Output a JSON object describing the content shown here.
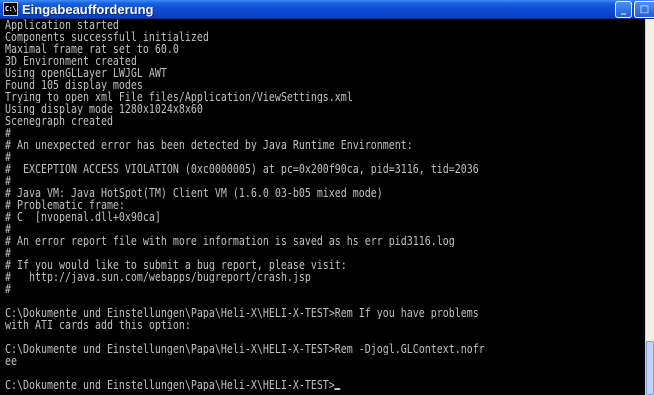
{
  "window": {
    "title": "Eingabeaufforderung",
    "icon_text": "C:\\",
    "minimize_glyph": "_",
    "maximize_glyph": "□"
  },
  "console": {
    "lines": [
      "Application started",
      "Components successfull initialized",
      "Maximal frame rat set to 60.0",
      "3D Environment created",
      "Using openGLLayer LWJGL_AWT",
      "Found 105 display modes",
      "Trying to open xml File files/Application/ViewSettings.xml",
      "Using display mode 1280x1024x8x60",
      "Scenegraph created",
      "#",
      "# An unexpected error has been detected by Java Runtime Environment:",
      "#",
      "#  EXCEPTION_ACCESS_VIOLATION (0xc0000005) at pc=0x200f90ca, pid=3116, tid=2036",
      "#",
      "# Java VM: Java HotSpot(TM) Client VM (1.6.0_03-b05 mixed mode)",
      "# Problematic frame:",
      "# C  [nvopenal.dll+0x90ca]",
      "#",
      "# An error report file with more information is saved as hs_err_pid3116.log",
      "#",
      "# If you would like to submit a bug report, please visit:",
      "#   http://java.sun.com/webapps/bugreport/crash.jsp",
      "#",
      "",
      "C:\\Dokumente und Einstellungen\\Papa\\Heli-X\\HELI-X-TEST>Rem If you have problems",
      "with ATI cards add this option:",
      "",
      "C:\\Dokumente und Einstellungen\\Papa\\Heli-X\\HELI-X-TEST>Rem -Djogl.GLContext.nofr",
      "ee",
      "",
      "C:\\Dokumente und Einstellungen\\Papa\\Heli-X\\HELI-X-TEST>"
    ]
  },
  "colors": {
    "console_text": "#c0c0c0",
    "console_bg": "#000000",
    "titlebar": "#0b46cc"
  }
}
